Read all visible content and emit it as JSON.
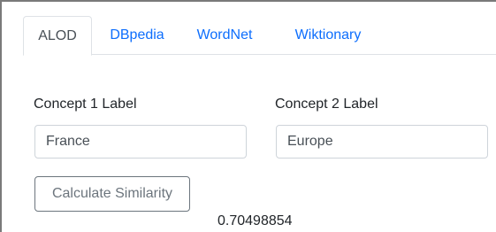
{
  "tabs": [
    {
      "label": "ALOD",
      "active": true
    },
    {
      "label": "DBpedia",
      "active": false
    },
    {
      "label": "WordNet",
      "active": false
    },
    {
      "label": "Wiktionary",
      "active": false
    }
  ],
  "form": {
    "concept1_label": "Concept 1 Label",
    "concept1_value": "France",
    "concept2_label": "Concept 2 Label",
    "concept2_value": "Europe",
    "calculate_button": "Calculate Similarity"
  },
  "result": {
    "similarity": "0.70498854"
  },
  "colors": {
    "link": "#0d6efd",
    "border": "#dee2e6",
    "button_outline": "#6c757d"
  }
}
